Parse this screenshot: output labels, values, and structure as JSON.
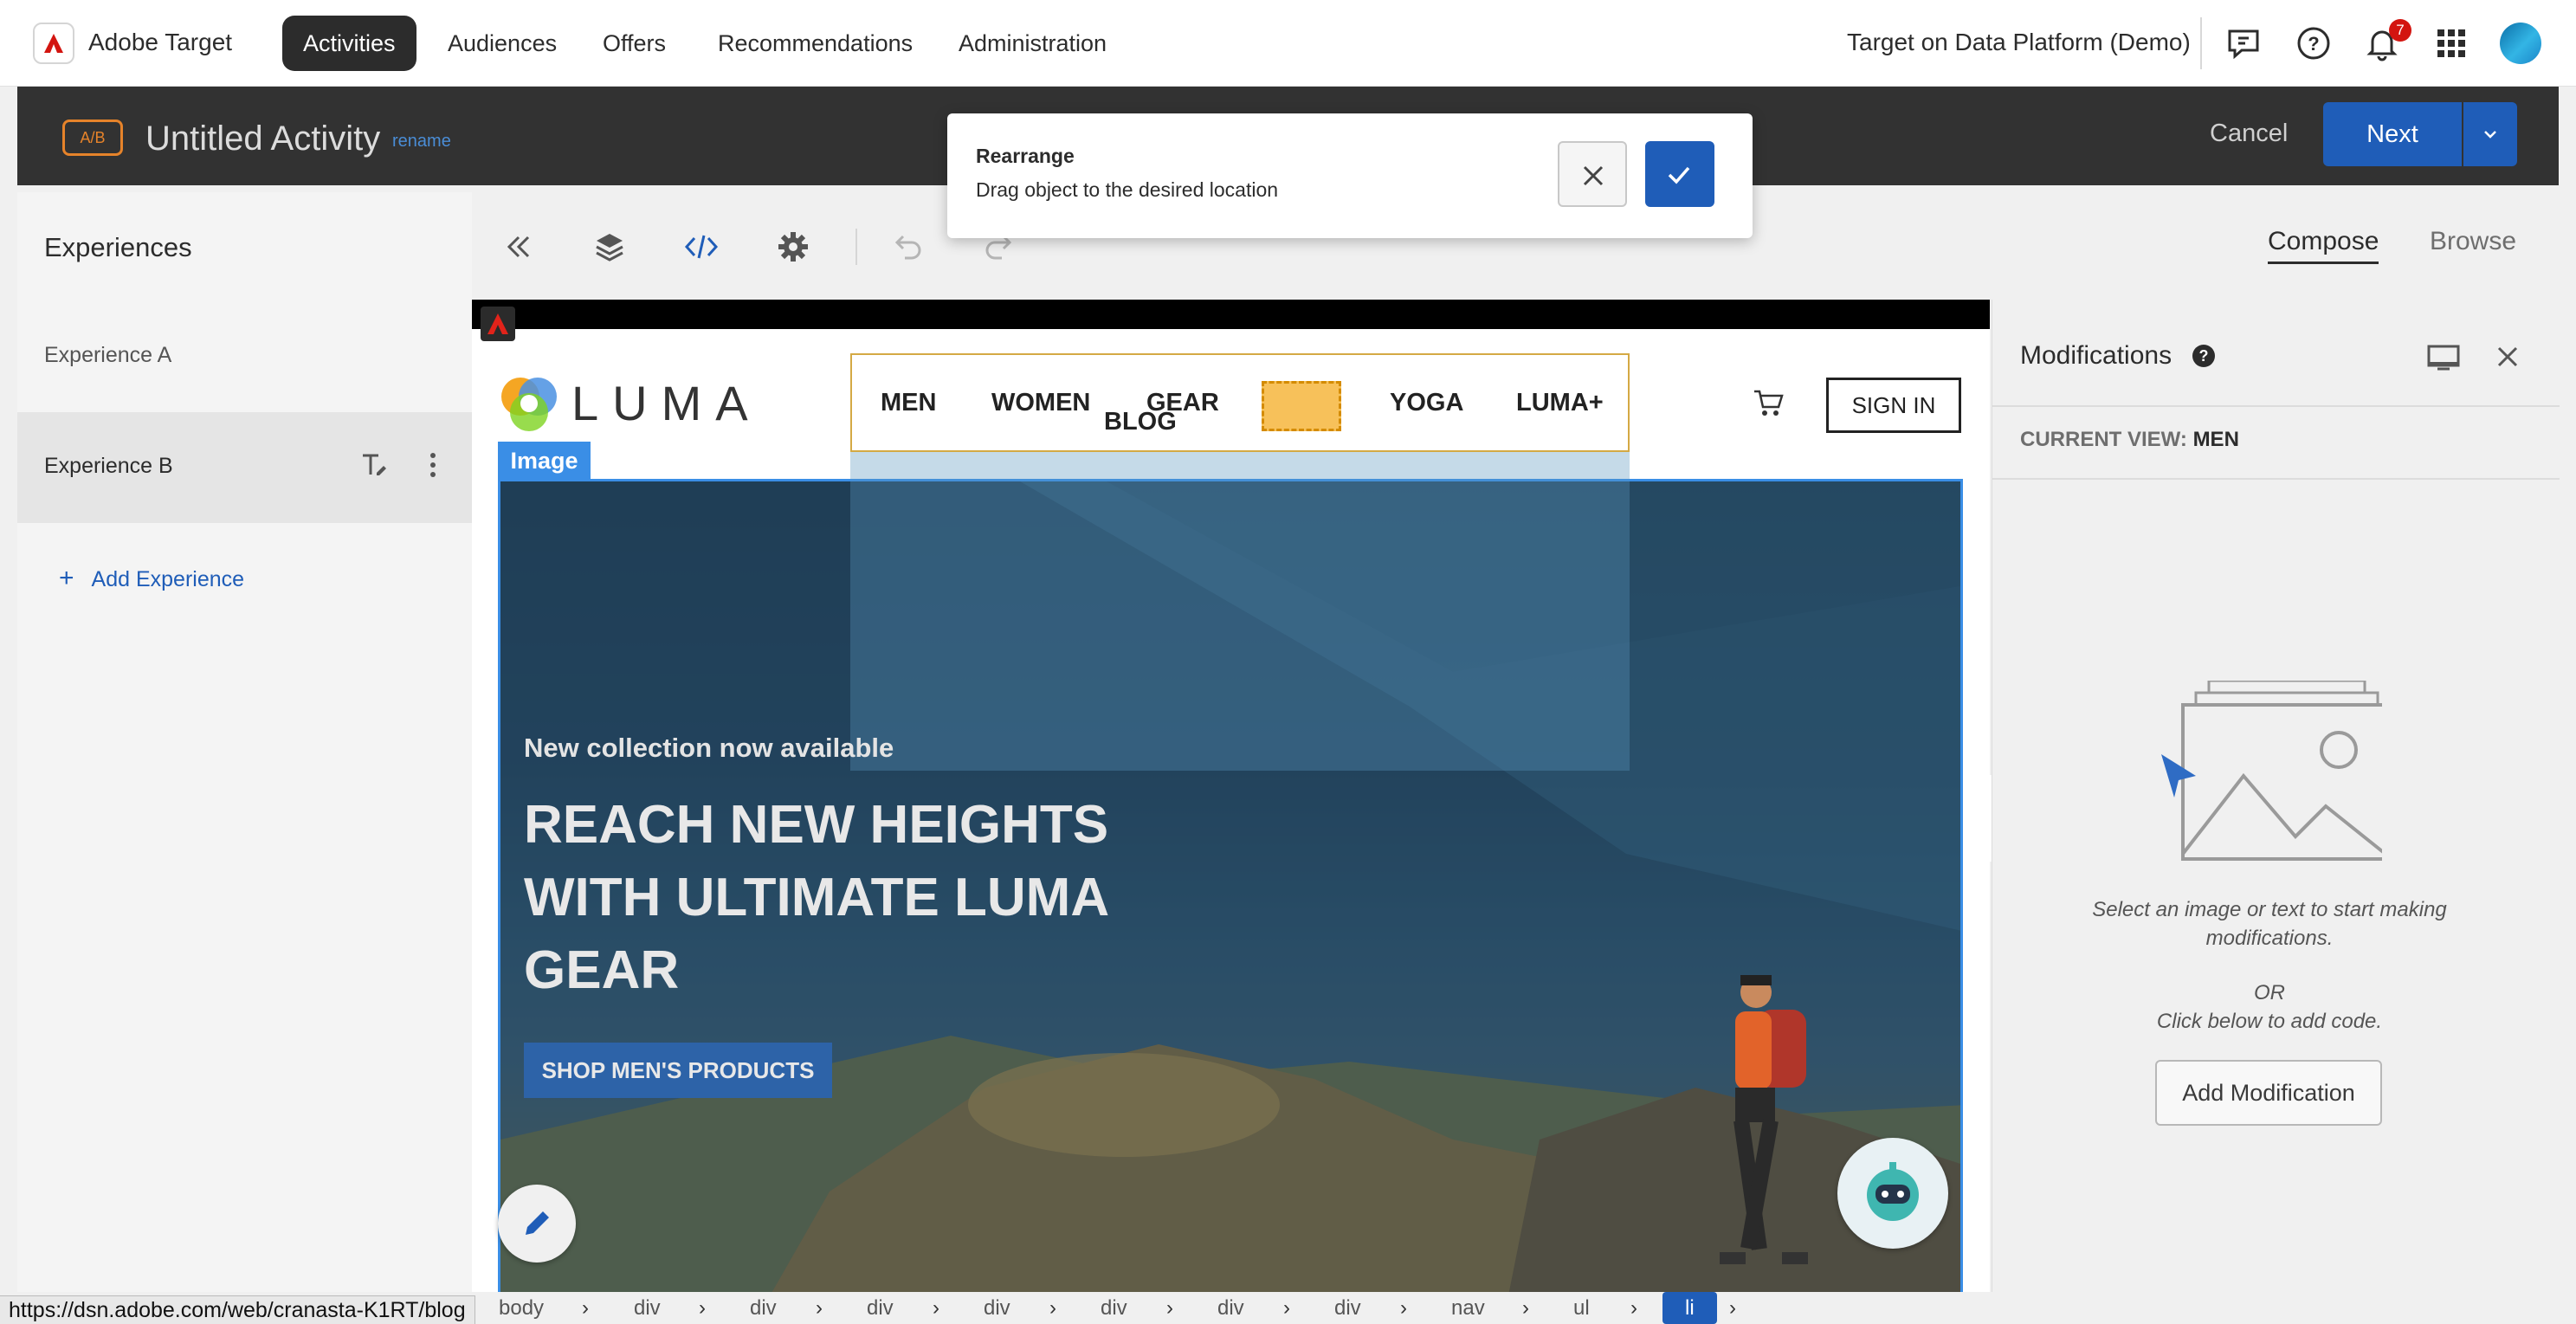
{
  "topnav": {
    "app_name": "Adobe Target",
    "items": [
      {
        "label": "Activities",
        "active": true
      },
      {
        "label": "Audiences",
        "active": false
      },
      {
        "label": "Offers",
        "active": false
      },
      {
        "label": "Recommendations",
        "active": false
      },
      {
        "label": "Administration",
        "active": false
      }
    ],
    "org_name": "Target on Data Platform (Demo)",
    "notification_count": "7",
    "icons": [
      "feedback-icon",
      "help-icon",
      "bell-icon",
      "apps-grid-icon",
      "user-avatar"
    ]
  },
  "activity": {
    "type_badge": "A/B",
    "title": "Untitled Activity",
    "rename_label": "rename",
    "cancel_label": "Cancel",
    "next_label": "Next"
  },
  "sidebar": {
    "title": "Experiences",
    "experiences": [
      {
        "label": "Experience A",
        "selected": false
      },
      {
        "label": "Experience B",
        "selected": true
      }
    ],
    "add_label": "Add Experience"
  },
  "toolbar": {
    "icons": [
      "collapse-left-icon",
      "layers-icon",
      "code-icon",
      "settings-icon",
      "undo-icon",
      "redo-icon"
    ],
    "tabs": [
      {
        "label": "Compose",
        "active": true
      },
      {
        "label": "Browse",
        "active": false
      }
    ]
  },
  "dialog": {
    "title": "Rearrange",
    "message": "Drag object to the desired location"
  },
  "preview": {
    "logo_text": "LUMA",
    "menu": [
      "MEN",
      "WOMEN",
      "GEAR",
      "YOGA",
      "LUMA+"
    ],
    "dragged_item": "BLOG",
    "sign_in": "SIGN IN",
    "element_tag": "Image",
    "hero_subtitle": "New collection now available",
    "hero_heading": "REACH NEW HEIGHTS WITH ULTIMATE LUMA GEAR",
    "hero_button": "SHOP MEN'S PRODUCTS"
  },
  "modifications": {
    "title": "Modifications",
    "help": "?",
    "current_view_label": "CURRENT VIEW:",
    "current_view_value": "MEN",
    "description": "Select an image or text to start making modifications.",
    "or_line1": "OR",
    "or_line2": "Click below to add code.",
    "add_button": "Add Modification"
  },
  "status": {
    "url": "https://dsn.adobe.com/web/cranasta-K1RT/blog",
    "breadcrumbs": [
      "body",
      "div",
      "div",
      "div",
      "div",
      "div",
      "div",
      "div",
      "nav",
      "ul",
      "li"
    ]
  }
}
